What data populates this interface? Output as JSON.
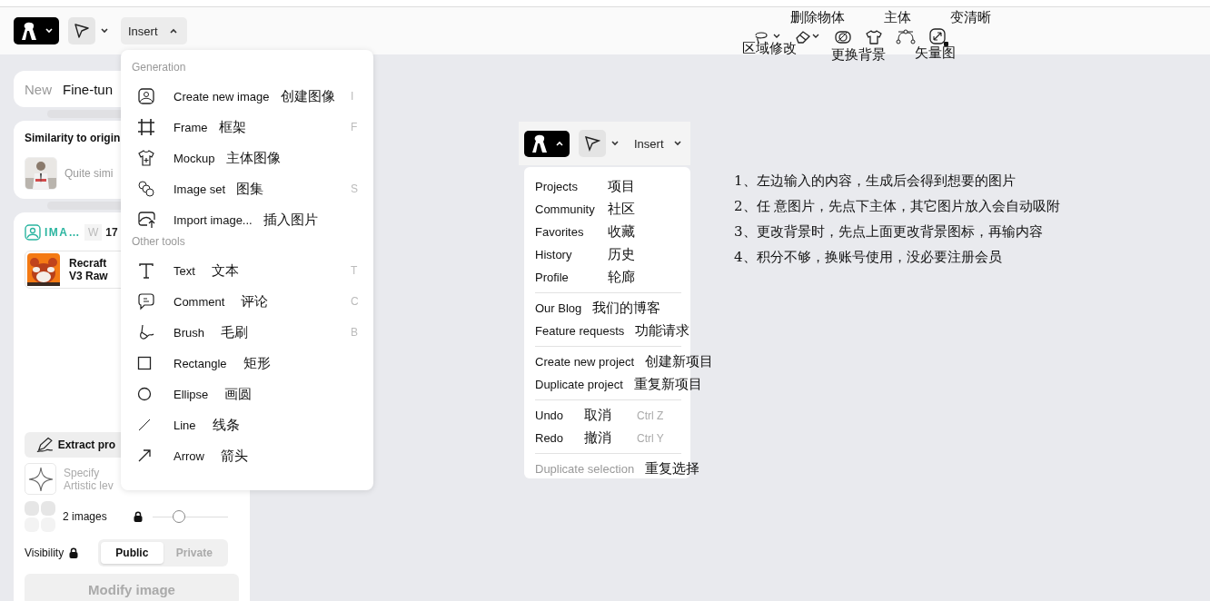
{
  "toolbar": {
    "insert_label": "Insert",
    "insert_open": true
  },
  "annotations": [
    {
      "text": "删除物体"
    },
    {
      "text": "主体"
    },
    {
      "text": "变清晰"
    },
    {
      "text": "区域修改"
    },
    {
      "text": "更换背景"
    },
    {
      "text": "矢量图"
    }
  ],
  "left_panel": {
    "tabs": [
      {
        "label": "New",
        "selected": false
      },
      {
        "label": "Fine-tun",
        "selected": true
      }
    ],
    "similarity": {
      "title": "Similarity to origin",
      "value": "Quite simi"
    },
    "image_section": {
      "label": "IMA…",
      "width_label": "W",
      "width_value": "17"
    },
    "model": {
      "name": "Recraft",
      "version": "V3 Raw"
    },
    "extract_button": "Extract pro",
    "style": {
      "line1": "Specify",
      "line2": "Artistic lev"
    },
    "images": {
      "label": "2 images",
      "level": 0.35
    },
    "visibility": {
      "label": "Visibility",
      "options": [
        {
          "label": "Public",
          "selected": true
        },
        {
          "label": "Private",
          "selected": false
        }
      ]
    },
    "submit": {
      "label": "Modify image",
      "disabled": true
    }
  },
  "insert_menu": {
    "sections": [
      {
        "title": "Generation",
        "items": [
          {
            "label": "Create new image",
            "translation": "创建图像",
            "shortcut": "I"
          },
          {
            "label": "Frame",
            "translation": "框架",
            "shortcut": "F"
          },
          {
            "label": "Mockup",
            "translation": "主体图像"
          },
          {
            "label": "Image set",
            "translation": "图集",
            "shortcut": "S"
          },
          {
            "label": "Import image...",
            "translation": "插入图片"
          }
        ]
      },
      {
        "title": "Other tools",
        "items": [
          {
            "label": "Text",
            "translation": "文本",
            "shortcut": "T"
          },
          {
            "label": "Comment",
            "translation": "评论",
            "shortcut": "C"
          },
          {
            "label": "Brush",
            "translation": "毛刷",
            "shortcut": "B"
          },
          {
            "label": "Rectangle",
            "translation": "矩形"
          },
          {
            "label": "Ellipse",
            "translation": "画圆"
          },
          {
            "label": "Line",
            "translation": "线条"
          },
          {
            "label": "Arrow",
            "translation": "箭头"
          }
        ]
      }
    ]
  },
  "inset": {
    "insert_label": "Insert",
    "groups": [
      {
        "items": [
          {
            "label": "Projects",
            "translation": "项目",
            "disabled": false
          },
          {
            "label": "Community",
            "translation": "社区",
            "disabled": false
          },
          {
            "label": "Favorites",
            "translation": "收藏",
            "disabled": false
          },
          {
            "label": "History",
            "translation": "历史",
            "disabled": false
          },
          {
            "label": "Profile",
            "translation": "轮廊",
            "disabled": false
          }
        ]
      },
      {
        "items": [
          {
            "label": "Our Blog",
            "translation": "我们的博客",
            "disabled": false
          },
          {
            "label": "Feature requests",
            "translation": "功能请求",
            "disabled": false
          }
        ]
      },
      {
        "items": [
          {
            "label": "Create new project",
            "translation": "创建新项目",
            "disabled": false
          },
          {
            "label": "Duplicate project",
            "translation": "重复新项目",
            "disabled": false
          }
        ]
      },
      {
        "items": [
          {
            "label": "Undo",
            "translation": "取消",
            "shortcut": "Ctrl Z",
            "disabled": false
          },
          {
            "label": "Redo",
            "translation": "撤消",
            "shortcut": "Ctrl Y",
            "disabled": false
          }
        ]
      },
      {
        "items": [
          {
            "label": "Duplicate selection",
            "translation": "重复选择",
            "disabled": true
          }
        ]
      }
    ]
  },
  "notes": [
    {
      "text": "1、左边输入的内容，生成后会得到想要的图片"
    },
    {
      "text": "2、任 意图片，先点下主体，其它图片放入会自动吸附"
    },
    {
      "text": "3、更改背景时，先点上面更改背景图标，再输内容"
    },
    {
      "text": "4、积分不够，换账号使用，没必要注册会员"
    }
  ]
}
